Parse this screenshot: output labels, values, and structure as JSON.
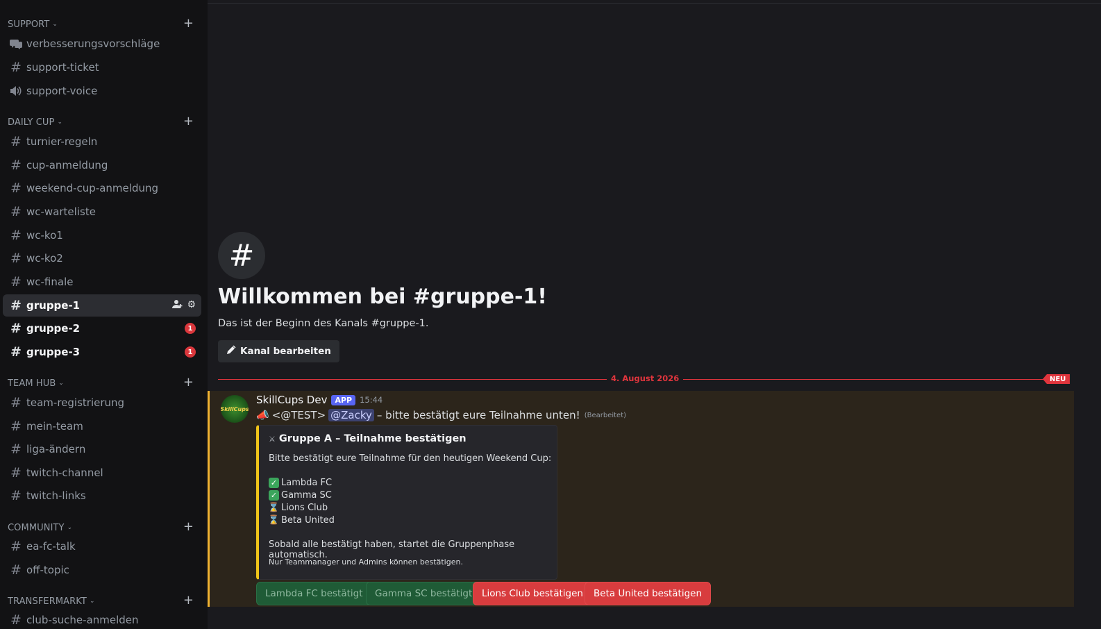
{
  "sidebar": {
    "categories": [
      {
        "label": "SUPPORT"
      },
      {
        "label": "DAILY CUP"
      },
      {
        "label": "TEAM HUB"
      },
      {
        "label": "COMMUNITY"
      },
      {
        "label": "TRANSFERMARKT"
      }
    ],
    "channels": {
      "support": [
        {
          "label": "verbesserungsvorschläge",
          "icon": "forum-icon"
        },
        {
          "label": "support-ticket",
          "icon": "hash-icon"
        },
        {
          "label": "support-voice",
          "icon": "speaker-icon"
        }
      ],
      "daily_cup": [
        {
          "label": "turnier-regeln"
        },
        {
          "label": "cup-anmeldung"
        },
        {
          "label": "weekend-cup-anmeldung"
        },
        {
          "label": "wc-warteliste"
        },
        {
          "label": "wc-ko1"
        },
        {
          "label": "wc-ko2"
        },
        {
          "label": "wc-finale"
        },
        {
          "label": "gruppe-1",
          "active": true
        },
        {
          "label": "gruppe-2",
          "badge": "1"
        },
        {
          "label": "gruppe-3",
          "badge": "1"
        }
      ],
      "team_hub": [
        {
          "label": "team-registrierung"
        },
        {
          "label": "mein-team"
        },
        {
          "label": "liga-ändern"
        },
        {
          "label": "twitch-channel"
        },
        {
          "label": "twitch-links"
        }
      ],
      "community": [
        {
          "label": "ea-fc-talk"
        },
        {
          "label": "off-topic"
        }
      ],
      "transfermarkt": [
        {
          "label": "club-suche-anmelden"
        }
      ]
    }
  },
  "welcome": {
    "icon": "#",
    "title": "Willkommen bei #gruppe-1!",
    "subtitle": "Das ist der Beginn des Kanals #gruppe-1.",
    "edit_button": "Kanal bearbeiten"
  },
  "divider": {
    "date": "4. August 2026",
    "new_tag": "NEU"
  },
  "message": {
    "author": "SkillCups Dev",
    "app_tag": "APP",
    "time": "15:44",
    "avatar_text": "SkillCups",
    "prefix": "<@TEST>",
    "mention": "@Zacky",
    "text": "– bitte bestätigt eure Teilnahme unten!",
    "edited": "(Bearbeitet)",
    "embed": {
      "title": "Gruppe A – Teilnahme bestätigen",
      "description": "Bitte bestätigt eure Teilnahme für den heutigen Weekend Cup:",
      "teams": [
        {
          "name": "Lambda FC",
          "status": "confirmed"
        },
        {
          "name": "Gamma SC",
          "status": "confirmed"
        },
        {
          "name": "Lions Club",
          "status": "pending"
        },
        {
          "name": "Beta United",
          "status": "pending"
        }
      ],
      "footer1": "Sobald alle bestätigt haben, startet die Gruppenphase automatisch.",
      "footer2": "Nur Teammanager und Admins können bestätigen."
    },
    "buttons": [
      {
        "label": "Lambda FC bestätigt",
        "style": "success-disabled"
      },
      {
        "label": "Gamma SC bestätigt",
        "style": "success-disabled"
      },
      {
        "label": "Lions Club bestätigen",
        "style": "danger"
      },
      {
        "label": "Beta United bestätigen",
        "style": "danger"
      }
    ]
  },
  "colors": {
    "accent_new": "#e0353d",
    "app_tag": "#5865f2",
    "embed_bar": "#f0c419",
    "highlight_bar": "#f0b232"
  }
}
